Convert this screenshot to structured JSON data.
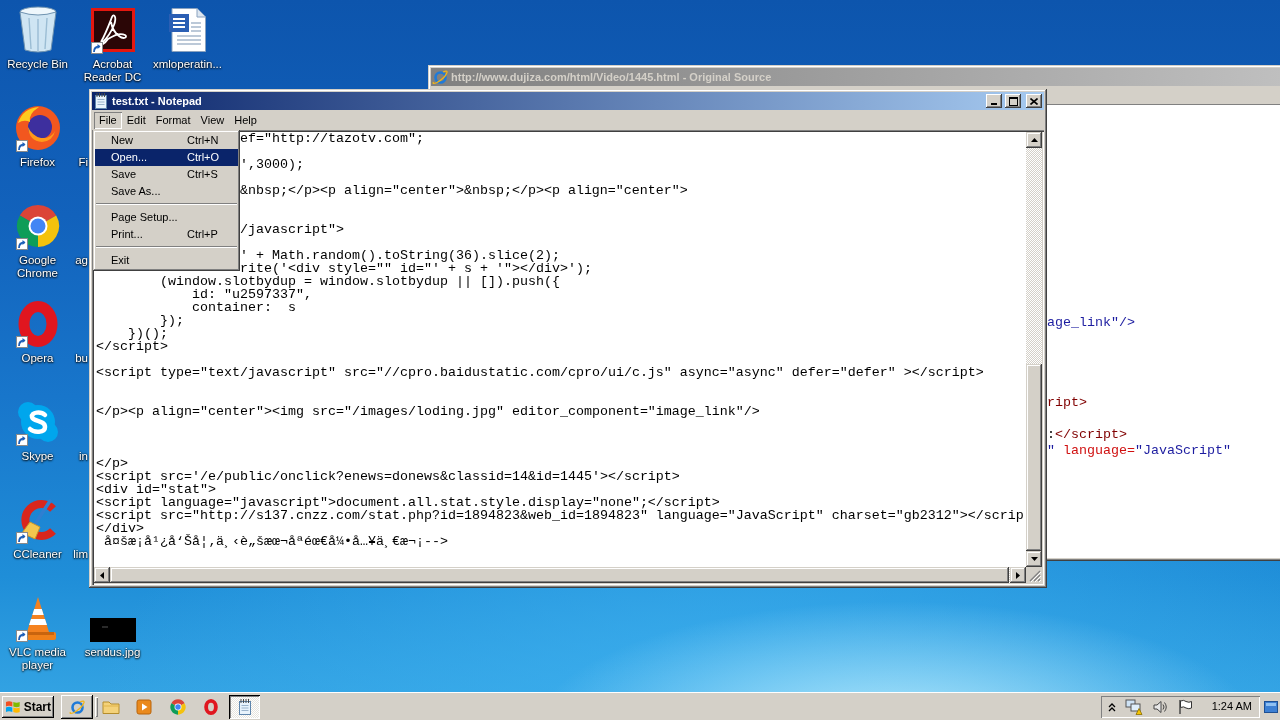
{
  "desktop": {
    "icon_columns": [
      [
        {
          "kind": "icon",
          "label": "Recycle Bin",
          "shortcut": false
        },
        {
          "kind": "icon",
          "label": "Firefox",
          "shortcut": true
        },
        {
          "kind": "icon",
          "label": "Google Chrome",
          "shortcut": true
        },
        {
          "kind": "icon",
          "label": "Opera",
          "shortcut": true
        },
        {
          "kind": "icon",
          "label": "Skype",
          "shortcut": true
        },
        {
          "kind": "icon",
          "label": "CCleaner",
          "shortcut": true
        },
        {
          "kind": "icon",
          "label": "VLC media player",
          "shortcut": true
        }
      ],
      [
        {
          "kind": "icon",
          "label": "Acrobat Reader DC",
          "shortcut": true
        },
        {
          "kind": "covered",
          "label": "Fi"
        },
        {
          "kind": "covered",
          "label": "ag"
        },
        {
          "kind": "covered",
          "label": "bu"
        },
        {
          "kind": "covered",
          "label": "in"
        },
        {
          "kind": "covered",
          "label": "lim"
        },
        {
          "kind": "icon",
          "label": "sendus.jpg",
          "shortcut": false
        }
      ],
      [
        {
          "kind": "icon",
          "label": "xmloperatin...",
          "shortcut": false
        }
      ]
    ]
  },
  "source_window": {
    "active": false,
    "title": "http://www.dujiza.com/html/Video/1445.html - Original Source",
    "lines": [
      {
        "kind": "code",
        "segments": [
          {
            "kind": "value",
            "text": "age_link\"/>"
          }
        ]
      },
      {
        "kind": "blank"
      },
      {
        "kind": "blank"
      },
      {
        "kind": "blank"
      },
      {
        "kind": "blank"
      },
      {
        "kind": "code",
        "segments": [
          {
            "kind": "tag",
            "text": "ript>"
          }
        ]
      },
      {
        "kind": "blank"
      },
      {
        "kind": "code",
        "segments": [
          {
            "kind": "text",
            "text": ":"
          },
          {
            "kind": "tag",
            "text": "</script>"
          }
        ]
      },
      {
        "kind": "code",
        "segments": [
          {
            "kind": "value",
            "text": "\""
          },
          {
            "kind": "attr",
            "text": " language="
          },
          {
            "kind": "value",
            "text": "\"JavaScript\""
          }
        ]
      }
    ]
  },
  "notepad": {
    "active": true,
    "title": "test.txt - Notepad",
    "menu_bar": [
      {
        "label": "File",
        "expanded": true
      },
      {
        "label": "Edit",
        "expanded": false
      },
      {
        "label": "Format",
        "expanded": false
      },
      {
        "label": "View",
        "expanded": false
      },
      {
        "label": "Help",
        "expanded": false
      }
    ],
    "file_menu": [
      {
        "kind": "item",
        "label": "New",
        "shortcut": "Ctrl+N",
        "selected": false
      },
      {
        "kind": "item",
        "label": "Open...",
        "shortcut": "Ctrl+O",
        "selected": true
      },
      {
        "kind": "item",
        "label": "Save",
        "shortcut": "Ctrl+S",
        "selected": false
      },
      {
        "kind": "item",
        "label": "Save As...",
        "selected": false
      },
      {
        "kind": "separator"
      },
      {
        "kind": "item",
        "label": "Page Setup...",
        "selected": false
      },
      {
        "kind": "item",
        "label": "Print...",
        "shortcut": "Ctrl+P",
        "selected": false
      },
      {
        "kind": "separator"
      },
      {
        "kind": "item",
        "label": "Exit",
        "selected": false
      }
    ],
    "lines": [
      {
        "kind": "partial",
        "text": "ef=\"http://tazotv.com\";"
      },
      {
        "kind": "blank"
      },
      {
        "kind": "partial",
        "text": "',3000);"
      },
      {
        "kind": "blank"
      },
      {
        "kind": "partial",
        "text": "&nbsp;</p><p align=\"center\">&nbsp;</p><p align=\"center\">"
      },
      {
        "kind": "blank"
      },
      {
        "kind": "blank"
      },
      {
        "kind": "partial",
        "text": "/javascript\">"
      },
      {
        "kind": "blank"
      },
      {
        "kind": "partial",
        "text": "' + Math.random().toString(36).slice(2);"
      },
      {
        "kind": "partial",
        "text": "rite('<div style=\"\" id=\"' + s + '\"></div>');"
      },
      {
        "kind": "full",
        "text": "        (window.slotbydup = window.slotbydup || []).push({"
      },
      {
        "kind": "full",
        "text": "            id: \"u2597337\","
      },
      {
        "kind": "full",
        "text": "            container:  s"
      },
      {
        "kind": "full",
        "text": "        });"
      },
      {
        "kind": "full",
        "text": "    })();"
      },
      {
        "kind": "full",
        "text": "</script>"
      },
      {
        "kind": "blank"
      },
      {
        "kind": "full",
        "text": "<script type=\"text/javascript\" src=\"//cpro.baidustatic.com/cpro/ui/c.js\" async=\"async\" defer=\"defer\" ></script>"
      },
      {
        "kind": "blank"
      },
      {
        "kind": "blank"
      },
      {
        "kind": "full",
        "text": "</p><p align=\"center\"><img src=\"/images/loding.jpg\" editor_component=\"image_link\"/>"
      },
      {
        "kind": "blank"
      },
      {
        "kind": "blank"
      },
      {
        "kind": "blank"
      },
      {
        "kind": "full",
        "text": "</p>"
      },
      {
        "kind": "full",
        "text": "<script src='/e/public/onclick?enews=donews&classid=14&id=1445'></script>"
      },
      {
        "kind": "full",
        "text": "<div id=\"stat\">"
      },
      {
        "kind": "full",
        "text": "<script language=\"javascript\">document.all.stat.style.display=\"none\";</script>"
      },
      {
        "kind": "full",
        "text": "<script src=\"http://s137.cnzz.com/stat.php?id=1894823&web_id=1894823\" language=\"JavaScript\" charset=\"gb2312\"></scrip"
      },
      {
        "kind": "full",
        "text": "</div>"
      },
      {
        "kind": "full",
        "text": " å¤šæ¡å¹¿å‘Šå¦‚ä¸‹è„šæœ¬åªéœ€å¼•å…¥ä¸€æ¬¡-->"
      }
    ]
  },
  "taskbar": {
    "start_label": "Start",
    "task_buttons": [
      {
        "selected": false
      },
      {
        "selected": true
      }
    ],
    "clock": "1:24 AM"
  }
}
